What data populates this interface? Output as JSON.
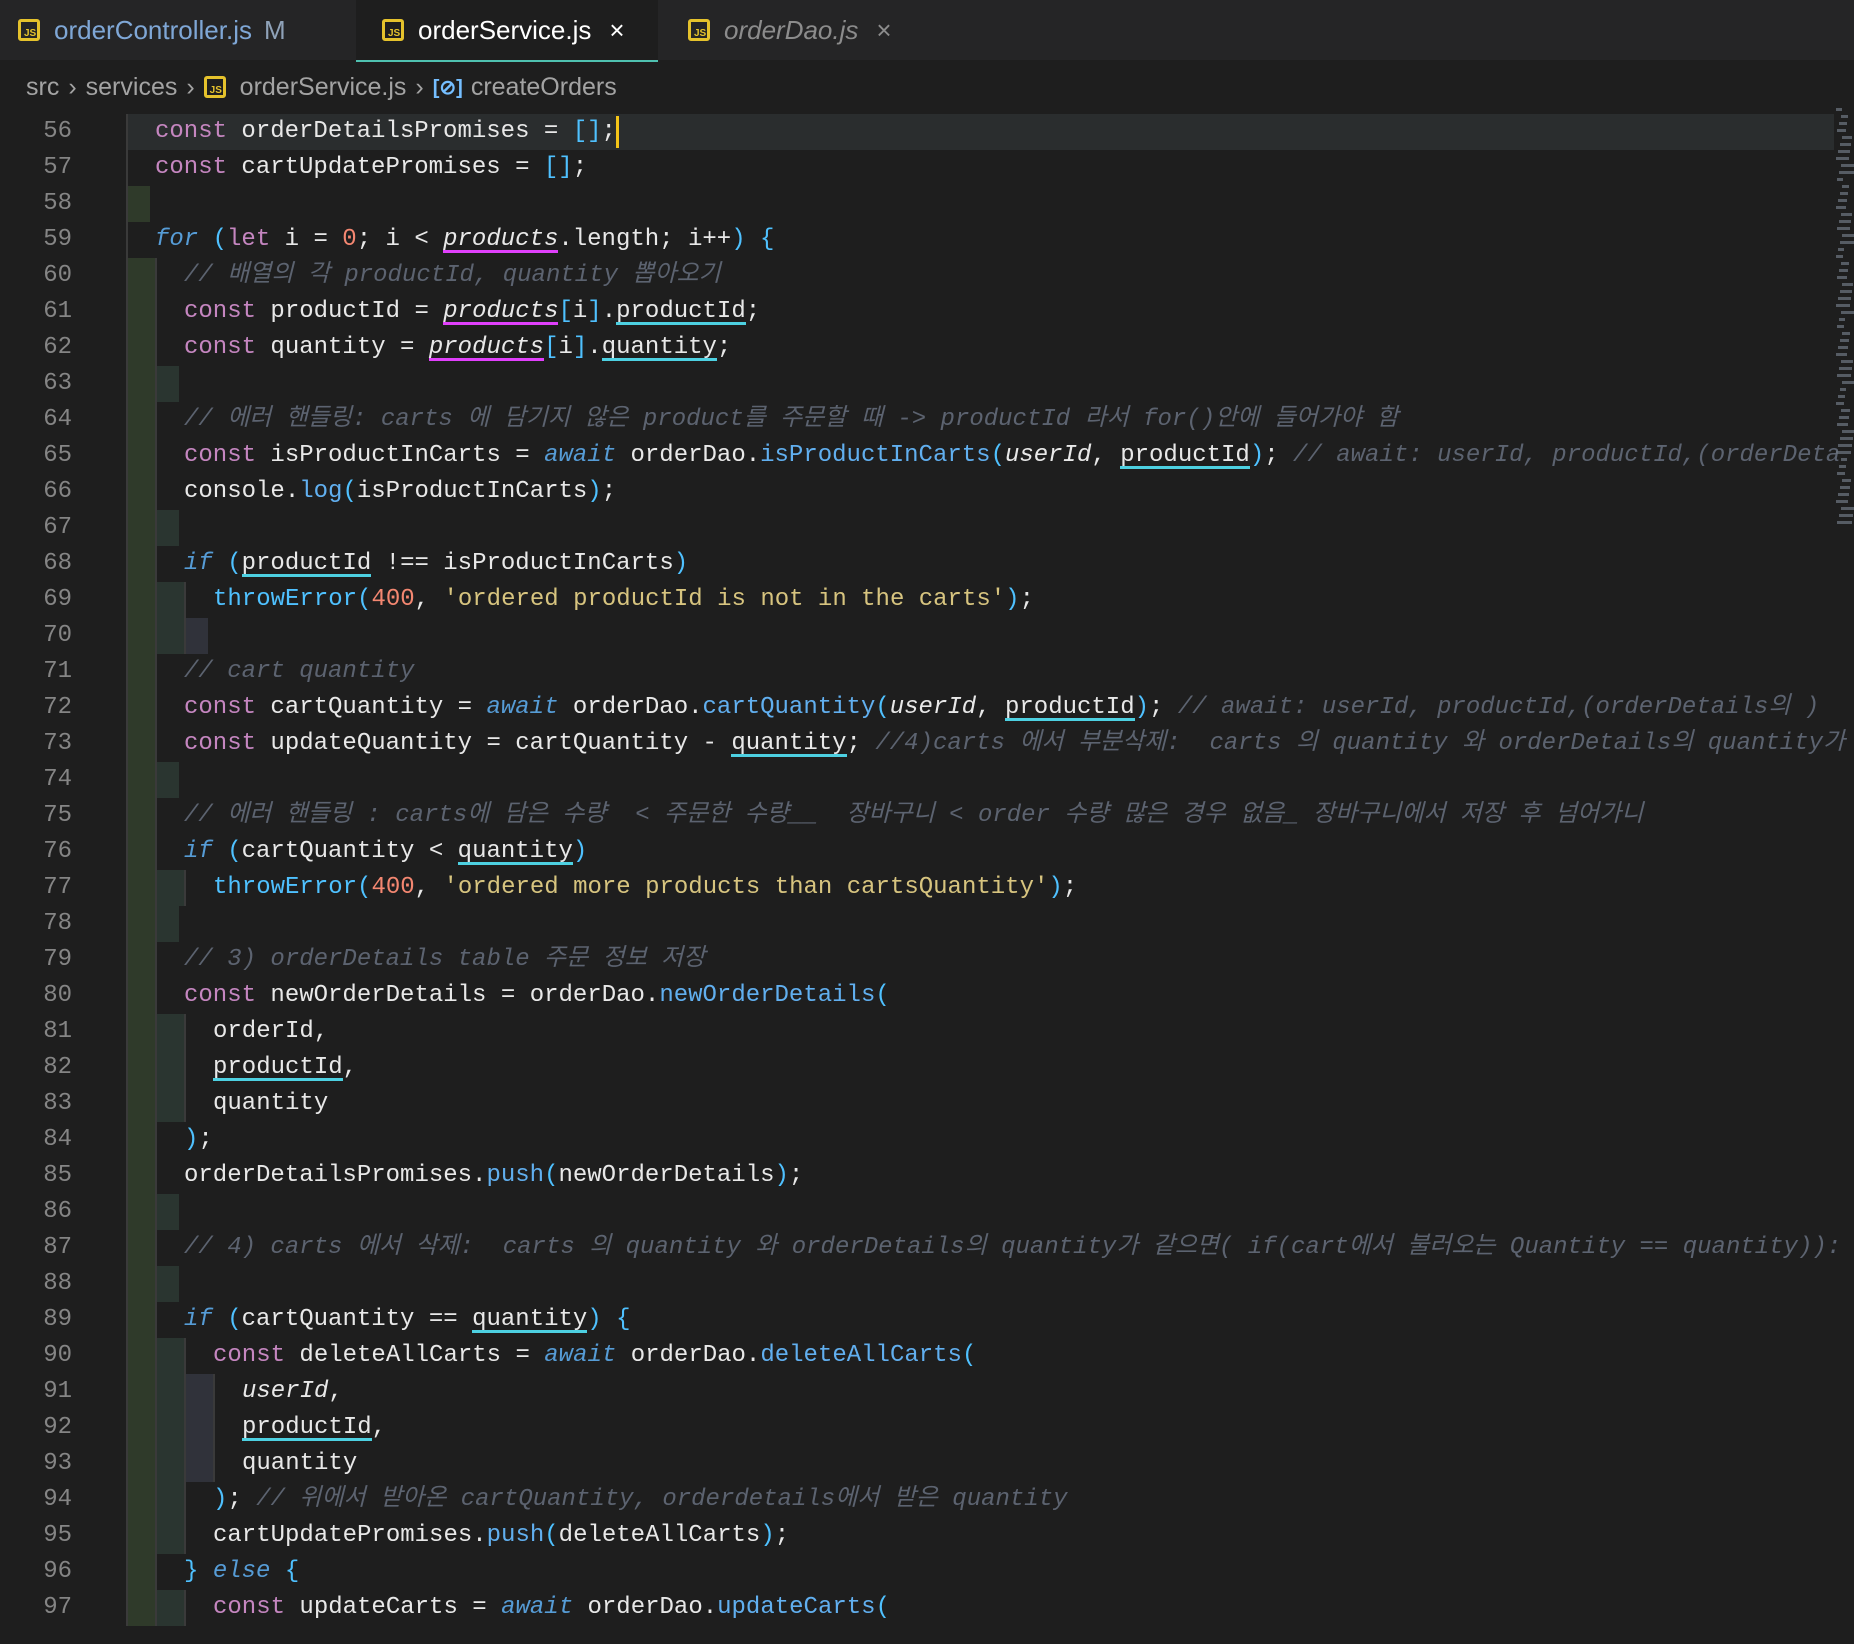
{
  "tabs": [
    {
      "label": "orderController.js",
      "modified_mark": "M",
      "state": "modified"
    },
    {
      "label": "orderService.js",
      "close_icon": "×",
      "state": "active"
    },
    {
      "label": "orderDao.js",
      "close_icon": "×",
      "state": "preview"
    }
  ],
  "breadcrumb": {
    "items": [
      "src",
      "services",
      "orderService.js",
      "createOrders"
    ],
    "separator": "›",
    "symbol_icon": "[⊘]"
  },
  "editor": {
    "cursor_line": 56,
    "lines": [
      {
        "n": 56,
        "text": "const orderDetailsPromises = [];"
      },
      {
        "n": 57,
        "text": "const cartUpdatePromises = [];"
      },
      {
        "n": 58,
        "text": ""
      },
      {
        "n": 59,
        "text": "for (let i = 0; i < products.length; i++) {"
      },
      {
        "n": 60,
        "text": "// 배열의 각 productId, quantity 뽑아오기"
      },
      {
        "n": 61,
        "text": "const productId = products[i].productId;"
      },
      {
        "n": 62,
        "text": "const quantity = products[i].quantity;"
      },
      {
        "n": 63,
        "text": ""
      },
      {
        "n": 64,
        "text": "// 에러 핸들링: carts 에 담기지 않은 product를 주문할 때 -> productId 라서 for()안에 들어가야 함"
      },
      {
        "n": 65,
        "text": "const isProductInCarts = await orderDao.isProductInCarts(userId, productId); // await: userId, productId,(orderDeta"
      },
      {
        "n": 66,
        "text": "console.log(isProductInCarts);"
      },
      {
        "n": 67,
        "text": ""
      },
      {
        "n": 68,
        "text": "if (productId !== isProductInCarts)"
      },
      {
        "n": 69,
        "text": "throwError(400, 'ordered productId is not in the carts');"
      },
      {
        "n": 70,
        "text": ""
      },
      {
        "n": 71,
        "text": "// cart quantity"
      },
      {
        "n": 72,
        "text": "const cartQuantity = await orderDao.cartQuantity(userId, productId); // await: userId, productId,(orderDetails의 )"
      },
      {
        "n": 73,
        "text": "const updateQuantity = cartQuantity - quantity; //4)carts 에서 부분삭제:  carts 의 quantity 와 orderDetails의 quantity가"
      },
      {
        "n": 74,
        "text": ""
      },
      {
        "n": 75,
        "text": "// 에러 핸들링 : carts에 담은 수량  < 주문한 수량__  장바구니 < order 수량 많은 경우 없음_ 장바구니에서 저장 후 넘어가니"
      },
      {
        "n": 76,
        "text": "if (cartQuantity < quantity)"
      },
      {
        "n": 77,
        "text": "throwError(400, 'ordered more products than cartsQuantity');"
      },
      {
        "n": 78,
        "text": ""
      },
      {
        "n": 79,
        "text": "// 3) orderDetails table 주문 정보 저장"
      },
      {
        "n": 80,
        "text": "const newOrderDetails = orderDao.newOrderDetails("
      },
      {
        "n": 81,
        "text": "orderId,"
      },
      {
        "n": 82,
        "text": "productId,"
      },
      {
        "n": 83,
        "text": "quantity"
      },
      {
        "n": 84,
        "text": ");"
      },
      {
        "n": 85,
        "text": "orderDetailsPromises.push(newOrderDetails);"
      },
      {
        "n": 86,
        "text": ""
      },
      {
        "n": 87,
        "text": "// 4) carts 에서 삭제:  carts 의 quantity 와 orderDetails의 quantity가 같으면( if(cart에서 불러오는 Quantity == quantity)):"
      },
      {
        "n": 88,
        "text": ""
      },
      {
        "n": 89,
        "text": "if (cartQuantity == quantity) {"
      },
      {
        "n": 90,
        "text": "const deleteAllCarts = await orderDao.deleteAllCarts("
      },
      {
        "n": 91,
        "text": "userId,"
      },
      {
        "n": 92,
        "text": "productId,"
      },
      {
        "n": 93,
        "text": "quantity"
      },
      {
        "n": 94,
        "text": "); // 위에서 받아온 cartQuantity, orderdetails에서 받은 quantity"
      },
      {
        "n": 95,
        "text": "cartUpdatePromises.push(deleteAllCarts);"
      },
      {
        "n": 96,
        "text": "} else {"
      },
      {
        "n": 97,
        "text": "const updateCarts = await orderDao.updateCarts("
      }
    ]
  },
  "colors": {
    "background": "#1e1e1e",
    "keyword": "#c586c0",
    "function": "#4fc1ff",
    "string": "#d7c47f",
    "number": "#f48771",
    "comment": "#5c6370",
    "underline_pink": "#e040fb",
    "underline_cyan": "#4dd0e1",
    "tab_active_border": "#4fc1b0",
    "cursor": "#f5c518"
  }
}
